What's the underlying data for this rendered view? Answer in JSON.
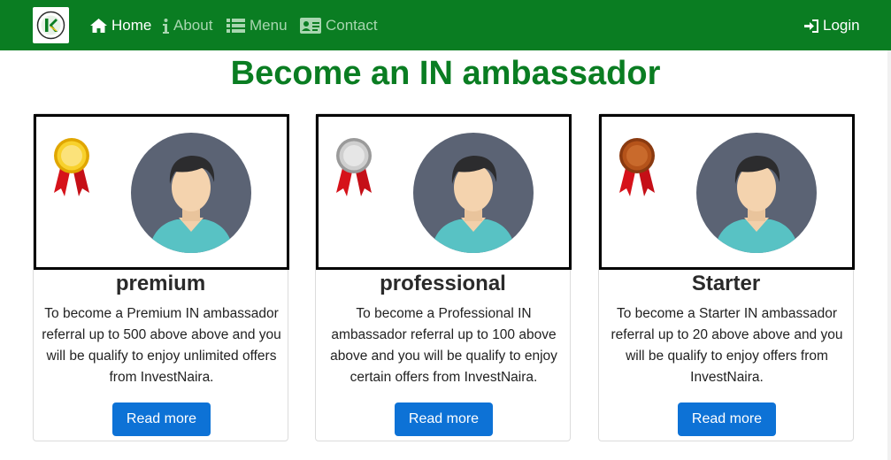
{
  "nav": {
    "home": "Home",
    "about": "About",
    "menu": "Menu",
    "contact": "Contact",
    "login": "Login"
  },
  "page_title": "Become an IN ambassador",
  "cards": [
    {
      "title": "premium",
      "medal": "gold-medal-icon",
      "text": "To become a Premium IN ambassador referral up to 500 above above and you will be qualify to enjoy unlimited offers from InvestNaira.",
      "button": "Read more"
    },
    {
      "title": "professional",
      "medal": "silver-medal-icon",
      "text": "To become a Professional IN ambassador referral up to 100 above above and you will be qualify to enjoy certain offers from InvestNaira.",
      "button": "Read more"
    },
    {
      "title": "Starter",
      "medal": "bronze-medal-icon",
      "text": "To become a Starter IN ambassador referral up to 20 above above and you will be qualify to enjoy offers from InvestNaira.",
      "button": "Read more"
    }
  ],
  "colors": {
    "brand_green": "#0a7d22",
    "button_blue": "#0d72d6",
    "gold": "#f2c21a",
    "silver": "#c9c9c9",
    "bronze": "#b5531a",
    "ribbon_red": "#d6121a"
  }
}
